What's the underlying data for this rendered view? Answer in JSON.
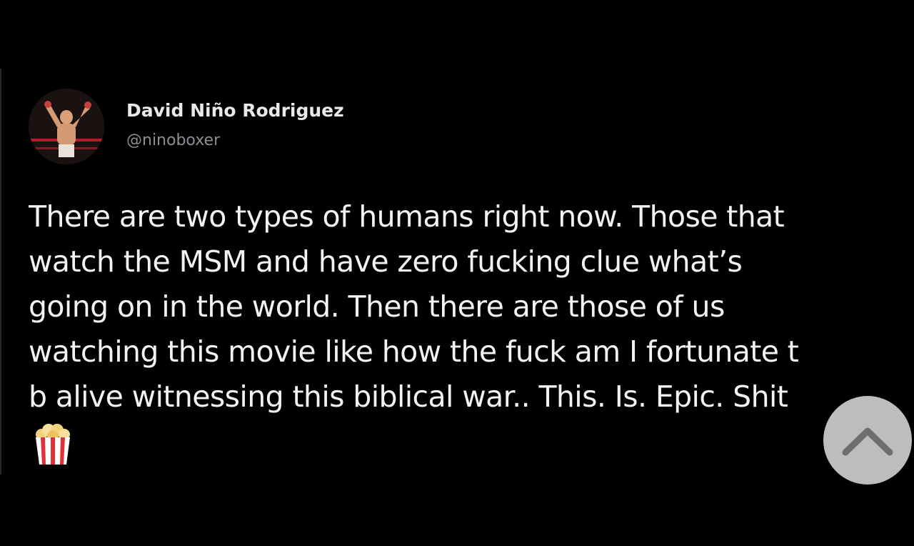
{
  "tweet": {
    "author": {
      "display_name": "David Niño Rodriguez",
      "handle": "@ninoboxer"
    },
    "text_lines": [
      "There are two types of humans right now. Those that",
      "watch the MSM and have zero fucking clue what’s",
      "going on in the world. Then there are those of us",
      "watching this movie like how the fuck am I fortunate t",
      "b alive witnessing this biblical war.. This. Is. Epic. Shit"
    ],
    "emoji": {
      "icon": "popcorn-icon",
      "char": "🍿"
    }
  },
  "scroll_to_top": {
    "icon": "chevron-up-icon",
    "color": "#bdbdbd",
    "icon_color": "#6e6e6e"
  },
  "colors": {
    "background": "#000000",
    "text": "#f2f2f2",
    "handle": "#8b8f94",
    "popcorn_red": "#e0303a"
  }
}
